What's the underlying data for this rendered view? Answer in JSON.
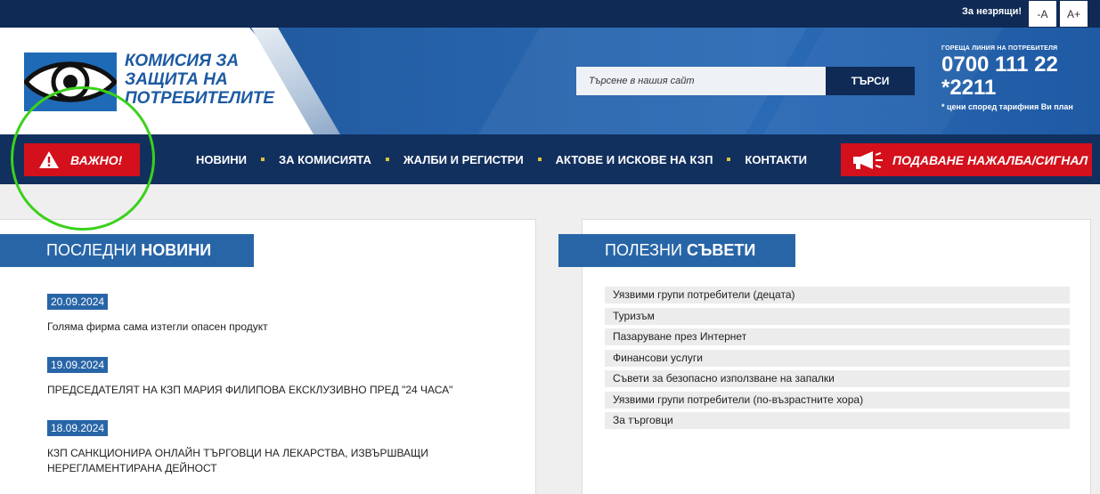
{
  "accessibility": {
    "label": "За незрящи!",
    "decrease": "-A",
    "increase": "A+"
  },
  "logo": {
    "lines": [
      "КОМИСИЯ ЗА",
      "ЗАЩИТА НА",
      "ПОТРЕБИТЕЛИТЕ"
    ],
    "icon": "eye-logo-icon"
  },
  "search": {
    "placeholder": "Търсене в нашия сайт",
    "button": "ТЪРСИ"
  },
  "hotline": {
    "label": "ГОРЕЩА ЛИНИЯ НА ПОТРЕБИТЕЛЯ",
    "number1": "0700 111 22",
    "number2": "*2211",
    "note": "* цени според тарифния Ви план"
  },
  "nav": {
    "important": "ВАЖНО!",
    "items": [
      "НОВИНИ",
      "ЗА КОМИСИЯТА",
      "ЖАЛБИ И РЕГИСТРИ",
      "АКТОВЕ И ИСКОВЕ НА КЗП",
      "КОНТАКТИ"
    ],
    "complaint": "ПОДАВАНЕ НАЖАЛБА/СИГНАЛ"
  },
  "news": {
    "title_light": "ПОСЛЕДНИ",
    "title_bold": "НОВИНИ",
    "items": [
      {
        "date": "20.09.2024",
        "title": "Голяма фирма сама изтегли опасен продукт"
      },
      {
        "date": "19.09.2024",
        "title": "ПРЕДСЕДАТЕЛЯТ НА КЗП МАРИЯ ФИЛИПОВА ЕКСКЛУЗИВНО ПРЕД \"24 ЧАСА\""
      },
      {
        "date": "18.09.2024",
        "title": "КЗП САНКЦИОНИРА ОНЛАЙН ТЪРГОВЦИ НА ЛЕКАРСТВА, ИЗВЪРШВАЩИ НЕРЕГЛАМЕНТИРАНА ДЕЙНОСТ"
      }
    ]
  },
  "tips": {
    "title_light": "ПОЛЕЗНИ",
    "title_bold": "СЪВЕТИ",
    "items": [
      "Уязвими групи потребители (децата)",
      "Туризъм",
      "Пазаруване през Интернет",
      "Финансови услуги",
      "Съвети за безопасно използване на запалки",
      "Уязвими групи потребители (по-възрастните хора)",
      "За търговци"
    ]
  },
  "colors": {
    "navy": "#12305e",
    "brand_blue": "#2865a7",
    "alert_red": "#d3101b",
    "annotation_green": "#3bd11b"
  }
}
